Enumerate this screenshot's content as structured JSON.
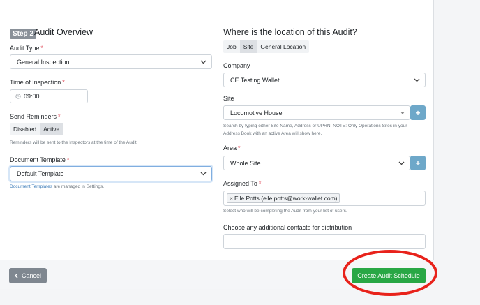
{
  "left": {
    "step_badge": "Step 2",
    "heading": "Audit Overview",
    "audit_type_label": "Audit Type",
    "audit_type_value": "General Inspection",
    "time_label": "Time of Inspection",
    "time_value": "09:00",
    "reminders_label": "Send Reminders",
    "reminders_options": [
      "Disabled",
      "Active"
    ],
    "reminders_help": "Reminders will be sent to the Inspectors at the time of the Audit.",
    "template_label": "Document Template",
    "template_value": "Default Template",
    "template_help_link": "Document Templates",
    "template_help_rest": "are managed in Settings."
  },
  "right": {
    "heading": "Where is the location of this Audit?",
    "location_options": [
      "Job",
      "Site",
      "General Location"
    ],
    "company_label": "Company",
    "company_value": "CE Testing Wallet",
    "site_label": "Site",
    "site_value": "Locomotive House",
    "site_help_1": "Search by typing either Site Name, Address or UPRN. NOTE: Only Operations Sites in your",
    "site_help_2": "Address Book with an active Area will show here.",
    "area_label": "Area",
    "area_value": "Whole Site",
    "assigned_label": "Assigned To",
    "assigned_tag": "Elle Potts (elle.potts@work-wallet.com)",
    "assigned_help": "Select who will be completing the Audit from your list of users.",
    "contacts_label": "Choose any additional contacts for distribution",
    "contacts_value": ""
  },
  "footer": {
    "cancel_label": "Cancel",
    "create_label": "Create Audit Schedule"
  },
  "required_mark": "*",
  "plus_label": "+",
  "icons": {
    "dropdown": "chevron-down-icon",
    "clock": "clock-icon",
    "back": "chevron-left-icon",
    "remove": "times-icon"
  },
  "colors": {
    "primary_button": "#28a745",
    "cancel_button": "#7f8790",
    "add_button": "#6ea8c9",
    "required": "#dc3545",
    "annotation_ring": "#e8221b"
  }
}
